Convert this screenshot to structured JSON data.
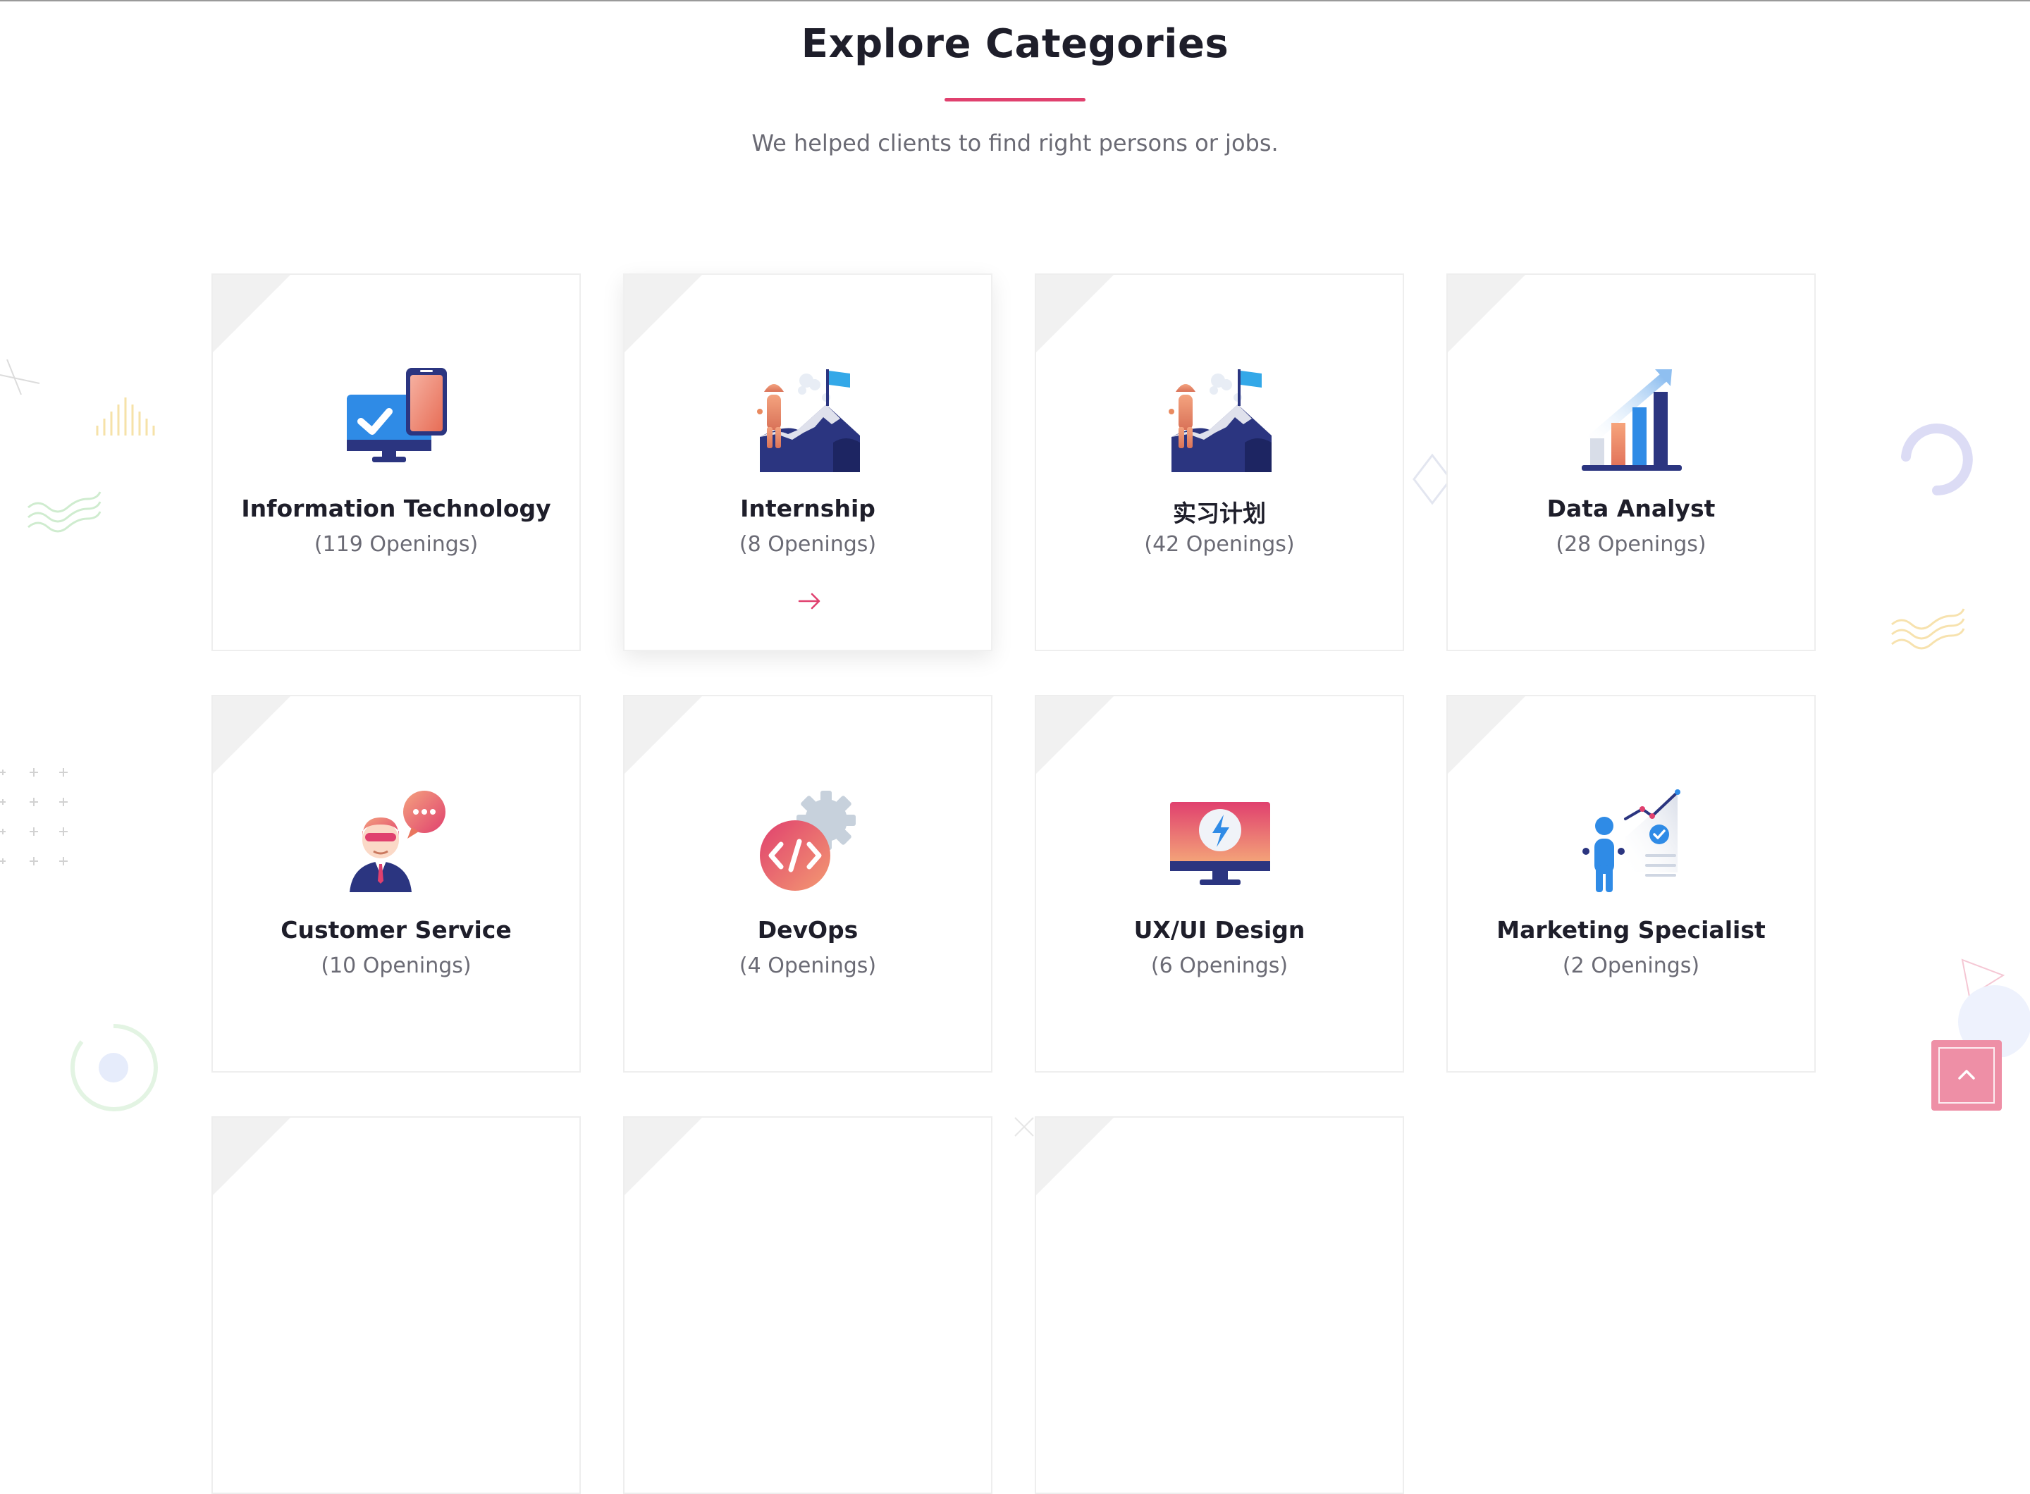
{
  "section": {
    "title": "Explore Categories",
    "subtitle": "We helped clients to find right persons or jobs."
  },
  "categories": [
    {
      "name": "Information Technology",
      "count": "(119 Openings)",
      "icon": "computer-phone-icon"
    },
    {
      "name": "Internship",
      "count": "(8 Openings)",
      "icon": "mountain-flag-icon"
    },
    {
      "name": "实习计划",
      "count": "(42 Openings)",
      "icon": "mountain-flag-icon"
    },
    {
      "name": "Data Analyst",
      "count": "(28 Openings)",
      "icon": "bar-chart-growth-icon"
    },
    {
      "name": "Customer Service",
      "count": "(10 Openings)",
      "icon": "support-agent-icon"
    },
    {
      "name": "DevOps",
      "count": "(4 Openings)",
      "icon": "code-gear-icon"
    },
    {
      "name": "UX/UI Design",
      "count": "(6 Openings)",
      "icon": "design-monitor-icon"
    },
    {
      "name": "Marketing Specialist",
      "count": "(2 Openings)",
      "icon": "marketing-person-icon"
    }
  ],
  "colors": {
    "accent": "#e0406e",
    "navy": "#2b3580",
    "orange": "#e98a5f",
    "blue": "#2f8be6",
    "scroll_top_button": "#ee8fa6"
  }
}
